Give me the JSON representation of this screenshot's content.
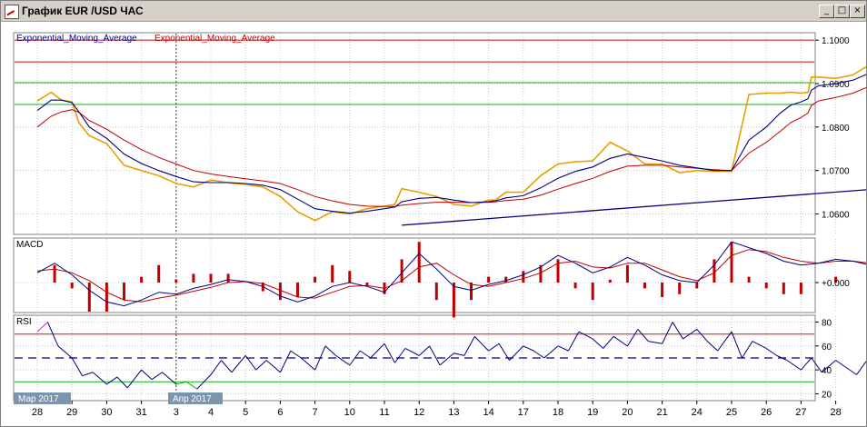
{
  "window": {
    "title": "График EUR /USD  ЧАС",
    "buttons": {
      "minimize": "_",
      "maximize": "□",
      "close": "×"
    }
  },
  "chart_data": [
    {
      "type": "line",
      "panel": "price",
      "legend": [
        "Exponential_Moving_Average",
        "Exponential_Moving_Average"
      ],
      "legend_colors": [
        "#000080",
        "#c00000"
      ],
      "ylim": [
        1.0555,
        1.1015
      ],
      "yticks": [
        1.06,
        1.07,
        1.08,
        1.09,
        1.1
      ],
      "ytick_labels": [
        "1.0600",
        "1.0700",
        "1.0800",
        "1.0900",
        "1.1000"
      ],
      "hlines": [
        {
          "value": 1.1,
          "color": "#d01010"
        },
        {
          "value": 1.095,
          "color": "#d01010"
        },
        {
          "value": 1.0902,
          "color": "#10b010"
        },
        {
          "value": 1.0852,
          "color": "#10b010"
        }
      ],
      "trendline": {
        "from": {
          "x": 10.5,
          "y": 1.0574
        },
        "to": {
          "x": 28.2,
          "y": 1.0682
        },
        "color": "#000080"
      },
      "series_colors": {
        "price": "#e8a000",
        "ema_fast": "#000080",
        "ema_slow": "#c00000"
      },
      "x": [
        0,
        0.4,
        0.7,
        1,
        1.2,
        1.5,
        2,
        2.5,
        3,
        3.5,
        4,
        4.5,
        5,
        5.5,
        6,
        6.5,
        7,
        7.5,
        8,
        8.5,
        9,
        9.5,
        10,
        10.3,
        10.5,
        11,
        11.5,
        12,
        12.5,
        13,
        13.2,
        13.5,
        14,
        14.5,
        15,
        15.5,
        16,
        16.5,
        17,
        17.5,
        18,
        18.5,
        19,
        19.5,
        20,
        20.5,
        21,
        21.4,
        21.7,
        22,
        22.2,
        22.3,
        22.5,
        23,
        23.5,
        24,
        24.2,
        24.5,
        24.7
      ],
      "price": [
        1.086,
        1.088,
        1.0862,
        1.0858,
        1.081,
        1.078,
        1.0762,
        1.0712,
        1.07,
        1.0688,
        1.067,
        1.0662,
        1.0678,
        1.0672,
        1.0668,
        1.0662,
        1.064,
        1.0605,
        1.0585,
        1.0605,
        1.06,
        1.0612,
        1.0618,
        1.0622,
        1.0658,
        1.065,
        1.064,
        1.0622,
        1.0618,
        1.0632,
        1.0632,
        1.065,
        1.065,
        1.0688,
        1.0715,
        1.072,
        1.0722,
        1.0765,
        1.0745,
        1.0715,
        1.0715,
        1.0695,
        1.07,
        1.0698,
        1.0698,
        1.0875,
        1.0878,
        1.0878,
        1.088,
        1.0878,
        1.088,
        1.0915,
        1.0915,
        1.0912,
        1.092,
        1.0945,
        1.094,
        1.094,
        1.0942
      ],
      "ema_fast": [
        1.0838,
        1.0862,
        1.0862,
        1.0856,
        1.0835,
        1.08,
        1.0774,
        1.0738,
        1.0716,
        1.07,
        1.0686,
        1.0674,
        1.0672,
        1.0672,
        1.067,
        1.0666,
        1.0656,
        1.0634,
        1.0612,
        1.0606,
        1.0602,
        1.0606,
        1.0612,
        1.0616,
        1.0628,
        1.0636,
        1.0638,
        1.0632,
        1.0626,
        1.0628,
        1.063,
        1.0637,
        1.0642,
        1.066,
        1.0682,
        1.0698,
        1.0708,
        1.0728,
        1.0738,
        1.073,
        1.0722,
        1.0712,
        1.0706,
        1.07,
        1.07,
        1.077,
        1.08,
        1.0832,
        1.085,
        1.0858,
        1.0865,
        1.0885,
        1.0895,
        1.09,
        1.0908,
        1.0925,
        1.093,
        1.0935,
        1.094
      ],
      "ema_slow": [
        1.08,
        1.0825,
        1.0835,
        1.084,
        1.0834,
        1.0815,
        1.0795,
        1.077,
        1.0748,
        1.073,
        1.0715,
        1.07,
        1.0692,
        1.0686,
        1.0681,
        1.0676,
        1.067,
        1.0656,
        1.064,
        1.063,
        1.0622,
        1.0618,
        1.0617,
        1.0617,
        1.062,
        1.0624,
        1.0627,
        1.0627,
        1.0626,
        1.0627,
        1.0628,
        1.0631,
        1.0634,
        1.0643,
        1.0657,
        1.067,
        1.0682,
        1.0698,
        1.071,
        1.0712,
        1.0712,
        1.0708,
        1.0705,
        1.0702,
        1.07,
        1.074,
        1.0765,
        1.079,
        1.081,
        1.0822,
        1.0832,
        1.085,
        1.086,
        1.0868,
        1.0878,
        1.0895,
        1.0902,
        1.091,
        1.0918
      ]
    },
    {
      "type": "line",
      "panel": "macd",
      "title": "MACD",
      "yticks": [
        0
      ],
      "ytick_labels": [
        "+0.000"
      ],
      "ylim": [
        -0.003,
        0.0045
      ],
      "series_colors": {
        "macd": "#000080",
        "signal": "#c00000",
        "histogram": "#c00000"
      },
      "x": [
        0,
        0.5,
        1,
        1.5,
        2,
        2.5,
        3,
        3.5,
        4,
        4.5,
        5,
        5.5,
        6,
        6.5,
        7,
        7.5,
        8,
        8.5,
        9,
        9.5,
        10,
        10.5,
        11,
        11.5,
        12,
        12.5,
        13,
        13.5,
        14,
        14.5,
        15,
        15.5,
        16,
        16.5,
        17,
        17.5,
        18,
        18.5,
        19,
        19.5,
        20,
        20.5,
        21,
        21.5,
        22,
        22.5,
        23,
        23.5,
        24,
        24.5
      ],
      "macd": [
        0.001,
        0.002,
        0.0008,
        -0.0008,
        -0.002,
        -0.0024,
        -0.0018,
        -0.001,
        -0.0012,
        -0.0006,
        -0.0002,
        0.0003,
        0.0001,
        -0.0004,
        -0.0014,
        -0.002,
        -0.0014,
        -0.0004,
        0.0,
        -0.0004,
        -0.001,
        0.001,
        0.003,
        0.0014,
        -0.0004,
        -0.0008,
        -0.0002,
        0.0002,
        0.0008,
        0.0016,
        0.0028,
        0.002,
        0.001,
        0.0016,
        0.0026,
        0.0018,
        0.0008,
        0.0002,
        0.0,
        0.0018,
        0.0042,
        0.0036,
        0.003,
        0.0022,
        0.0018,
        0.002,
        0.0024,
        0.0022,
        0.0018,
        0.0015
      ],
      "signal": [
        0.0012,
        0.0014,
        0.001,
        0.0002,
        -0.001,
        -0.0018,
        -0.002,
        -0.0016,
        -0.0013,
        -0.0009,
        -0.0005,
        0.0,
        0.0001,
        -0.0001,
        -0.0008,
        -0.0015,
        -0.0016,
        -0.001,
        -0.0004,
        -0.0003,
        -0.0006,
        0.0002,
        0.0016,
        0.002,
        0.0008,
        -0.0002,
        -0.0004,
        0.0,
        0.0004,
        0.001,
        0.002,
        0.0022,
        0.0016,
        0.0015,
        0.002,
        0.002,
        0.0013,
        0.0006,
        0.0002,
        0.001,
        0.0028,
        0.0034,
        0.0032,
        0.0026,
        0.0022,
        0.002,
        0.0022,
        0.0022,
        0.002,
        0.0017
      ]
    },
    {
      "type": "line",
      "panel": "rsi",
      "title": "RSI",
      "ylim": [
        15,
        85
      ],
      "yticks": [
        20,
        40,
        60,
        80
      ],
      "ytick_labels": [
        "20",
        "40",
        "60",
        "80"
      ],
      "levels": [
        {
          "value": 70,
          "color": "#d01010"
        },
        {
          "value": 50,
          "color": "#000080",
          "dashed": true
        },
        {
          "value": 30,
          "color": "#10b010"
        }
      ],
      "series_colors": {
        "normal": "#000080",
        "overbought": "#d020d0",
        "oversold": "#10b010"
      },
      "x": [
        0,
        0.3,
        0.6,
        1,
        1.3,
        1.6,
        2,
        2.3,
        2.6,
        3,
        3.3,
        3.6,
        4,
        4.3,
        4.6,
        5,
        5.3,
        5.6,
        6,
        6.3,
        6.6,
        7,
        7.3,
        7.6,
        8,
        8.3,
        8.6,
        9,
        9.3,
        9.6,
        10,
        10.3,
        10.6,
        11,
        11.3,
        11.6,
        12,
        12.3,
        12.6,
        13,
        13.3,
        13.6,
        14,
        14.3,
        14.6,
        15,
        15.3,
        15.6,
        16,
        16.3,
        16.6,
        17,
        17.3,
        17.6,
        18,
        18.3,
        18.6,
        19,
        19.3,
        19.6,
        20,
        20.3,
        20.6,
        21,
        21.3,
        21.6,
        22,
        22.3,
        22.6,
        23,
        23.3,
        23.6,
        24,
        24.3,
        24.6
      ],
      "values": [
        72,
        80,
        60,
        50,
        35,
        38,
        28,
        34,
        25,
        40,
        32,
        38,
        28,
        30,
        24,
        36,
        48,
        38,
        52,
        40,
        48,
        38,
        56,
        50,
        40,
        60,
        52,
        44,
        56,
        50,
        62,
        46,
        58,
        52,
        60,
        44,
        54,
        52,
        68,
        56,
        62,
        48,
        60,
        56,
        50,
        60,
        56,
        72,
        66,
        58,
        68,
        60,
        74,
        64,
        62,
        80,
        66,
        74,
        64,
        56,
        72,
        50,
        64,
        58,
        52,
        48,
        40,
        50,
        38,
        48,
        42,
        36,
        52,
        44,
        70
      ]
    }
  ],
  "x_axis": {
    "labels": [
      "28",
      "29",
      "30",
      "31",
      "3",
      "4",
      "5",
      "6",
      "7",
      "10",
      "11",
      "12",
      "13",
      "14",
      "17",
      "18",
      "19",
      "20",
      "21",
      "24",
      "25",
      "26",
      "27",
      "28"
    ],
    "month_labels": [
      "Мар 2017",
      "Апр 2017"
    ]
  }
}
